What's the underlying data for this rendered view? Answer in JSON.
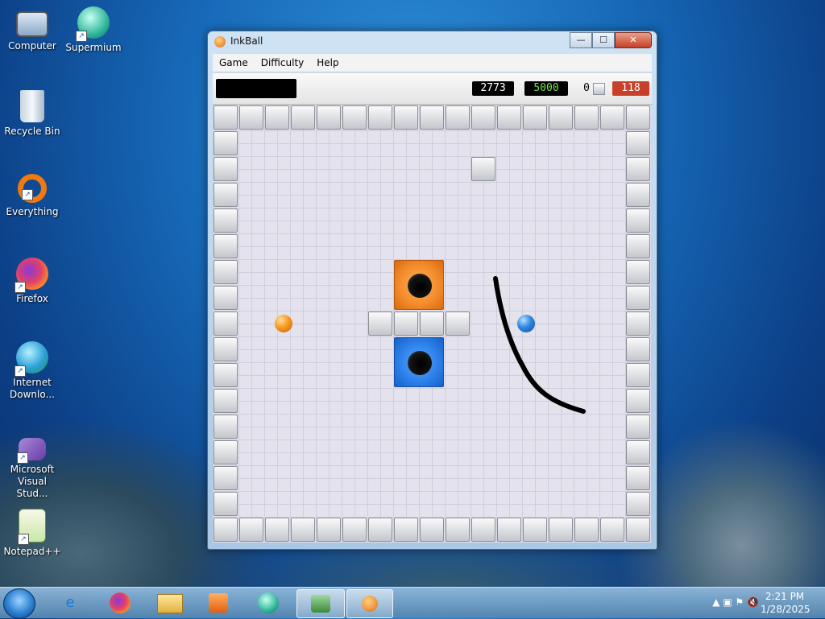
{
  "desktop": {
    "icons": [
      {
        "label": "Computer"
      },
      {
        "label": "Supermium"
      },
      {
        "label": "Recycle Bin"
      },
      {
        "label": "Everything"
      },
      {
        "label": "Firefox"
      },
      {
        "label": "Internet Downlo..."
      },
      {
        "label": "Microsoft Visual Stud..."
      },
      {
        "label": "Notepad++"
      }
    ]
  },
  "window": {
    "title": "InkBall",
    "buttons": {
      "minimize": "—",
      "maximize": "☐",
      "close": "✕"
    }
  },
  "menu": {
    "items": [
      "Game",
      "Difficulty",
      "Help"
    ]
  },
  "scoreboard": {
    "score": "2773",
    "target": "5000",
    "balls_remaining": "0",
    "time": "118",
    "colors": {
      "target_text": "#7ce04a",
      "time_bg": "#c8402a"
    }
  },
  "board": {
    "balls": [
      {
        "color": "orange"
      },
      {
        "color": "blue"
      }
    ],
    "holes": [
      {
        "color": "orange"
      },
      {
        "color": "blue"
      }
    ]
  },
  "taskbar": {
    "apps": [
      "internet-explorer",
      "firefox",
      "file-explorer",
      "media-player",
      "supermium",
      "network-app",
      "inkball"
    ],
    "active_app": "inkball",
    "clock": {
      "time": "2:21 PM",
      "date": "1/28/2025"
    }
  }
}
